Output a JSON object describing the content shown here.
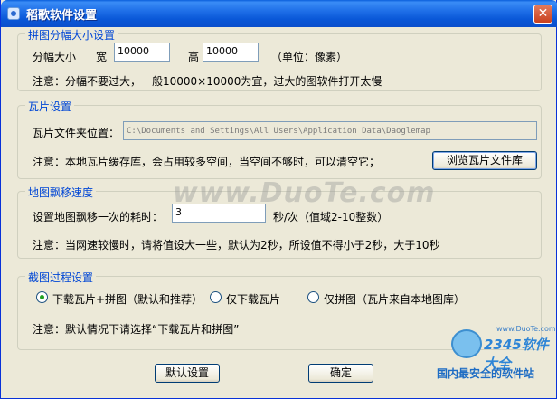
{
  "window": {
    "title": "稻歌软件设置",
    "close_glyph": "✕"
  },
  "tile_size": {
    "legend": "拼图分幅大小设置",
    "label": "分幅大小",
    "width_label": "宽",
    "width_value": "10000",
    "height_label": "高",
    "height_value": "10000",
    "unit": "（单位：像素）",
    "note": "注意：分幅不要过大，一般10000×10000为宜，过大的图软件打开太慢"
  },
  "tile": {
    "legend": "瓦片设置",
    "folder_label": "瓦片文件夹位置：",
    "folder_value": "C:\\Documents and Settings\\All Users\\Application Data\\Daoglemap",
    "note": "注意：本地瓦片缓存库，会占用较多空间，当空间不够时，可以清空它；",
    "browse_button": "浏览瓦片文件库"
  },
  "speed": {
    "legend": "地图飘移速度",
    "label": "设置地图飘移一次的耗时：",
    "value": "3",
    "unit": "秒/次（值域2-10整数）",
    "note": "注意：当网速较慢时，请将值设大一些，默认为2秒，所设值不得小于2秒，大于10秒"
  },
  "process": {
    "legend": "截图过程设置",
    "options": [
      {
        "label": "下载瓦片+拼图（默认和推荐）",
        "checked": true
      },
      {
        "label": "仅下载瓦片",
        "checked": false
      },
      {
        "label": "仅拼图（瓦片来自本地图库）",
        "checked": false
      }
    ],
    "note": "注意：默认情况下请选择“下载瓦片和拼图”"
  },
  "buttons": {
    "default": "默认设置",
    "ok": "确定"
  },
  "watermark": "www.DuoTe.com",
  "corner_logo": {
    "brand": "2345软件大全",
    "tagline": "国内最安全的软件站",
    "url": "www.DuoTe.com"
  },
  "colors": {
    "title_bar": "#0a58d8",
    "legend": "#0046d5",
    "face": "#ece9d8"
  }
}
